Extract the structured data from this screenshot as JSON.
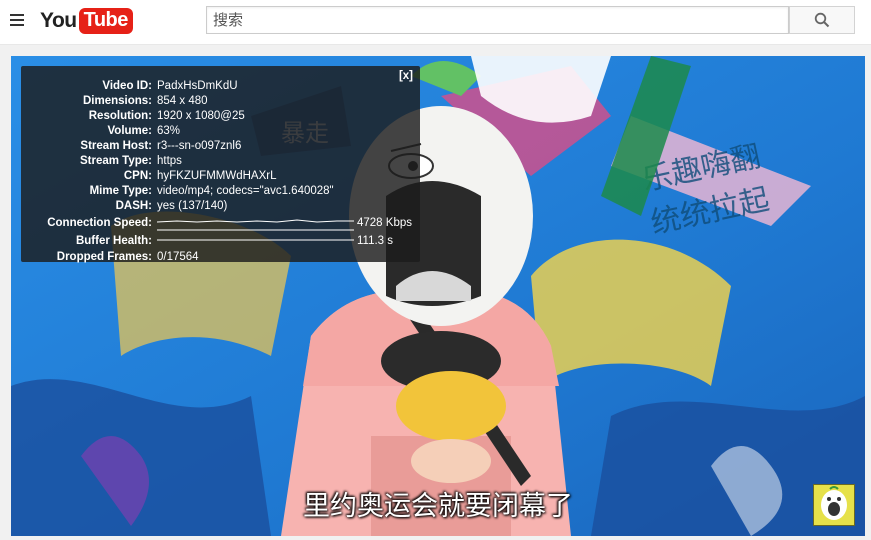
{
  "header": {
    "logo_you": "You",
    "logo_tube": "Tube",
    "search_placeholder": "搜索",
    "icons": {
      "menu": "hamburger-menu-icon",
      "search": "search-icon"
    }
  },
  "player": {
    "subtitle": "里约奥运会就要闭幕了",
    "stats_close": "[x]",
    "stats": {
      "video_id": {
        "label": "Video ID:",
        "value": "PadxHsDmKdU"
      },
      "dimensions": {
        "label": "Dimensions:",
        "value": "854 x 480"
      },
      "resolution": {
        "label": "Resolution:",
        "value": "1920 x 1080@25"
      },
      "volume": {
        "label": "Volume:",
        "value": "63%"
      },
      "stream_host": {
        "label": "Stream Host:",
        "value": "r3---sn-o097znl6"
      },
      "stream_type": {
        "label": "Stream Type:",
        "value": "https"
      },
      "cpn": {
        "label": "CPN:",
        "value": "hyFKZUFMMWdHAXrL"
      },
      "mime_type": {
        "label": "Mime Type:",
        "value": "video/mp4; codecs=\"avc1.640028\""
      },
      "dash": {
        "label": "DASH:",
        "value": "yes (137/140)"
      },
      "connection_speed": {
        "label": "Connection Speed:",
        "value": "4728 Kbps"
      },
      "buffer_health": {
        "label": "Buffer Health:",
        "value": "111.3 s"
      },
      "dropped_frames": {
        "label": "Dropped Frames:",
        "value": "0/17564"
      }
    },
    "colors": {
      "background_blue": "#1f7fd8",
      "accent_red": "#e62117",
      "badge_yellow": "#e6e14a"
    }
  }
}
